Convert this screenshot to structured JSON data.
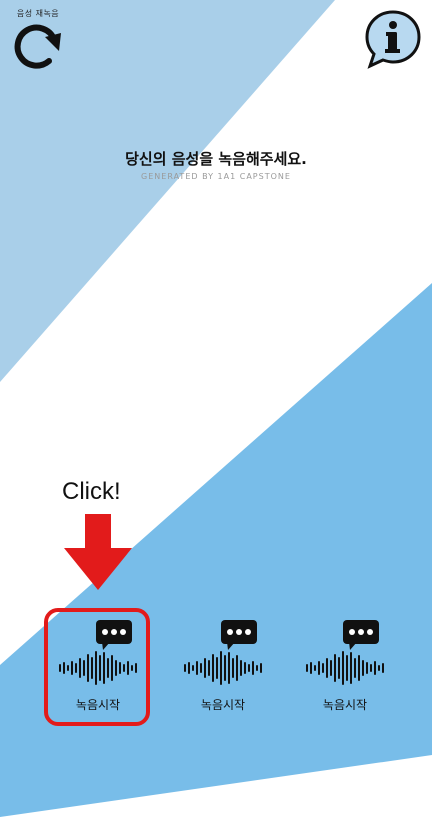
{
  "header": {
    "rerecord_label": "음성 재녹음",
    "rerecord_icon": "refresh-arrow-icon",
    "info_icon": "info-speech-bubble-icon"
  },
  "main": {
    "title": "당신의 음성을 녹음해주세요.",
    "subtitle": "GENERATED BY 1A1 CAPSTONE"
  },
  "hint": {
    "text": "Click!",
    "arrow_icon": "down-arrow-icon",
    "arrow_color": "#e21b1b"
  },
  "record_buttons": [
    {
      "label": "녹음시작",
      "icon": "voice-waveform-chat-icon",
      "highlighted": true
    },
    {
      "label": "녹음시작",
      "icon": "voice-waveform-chat-icon",
      "highlighted": false
    },
    {
      "label": "녹음시작",
      "icon": "voice-waveform-chat-icon",
      "highlighted": false
    }
  ],
  "colors": {
    "light_blue": "#a9cfe9",
    "mid_blue": "#78bde9",
    "highlight_red": "#e21b1b",
    "info_bubble_fill": "#b8d9f0"
  }
}
